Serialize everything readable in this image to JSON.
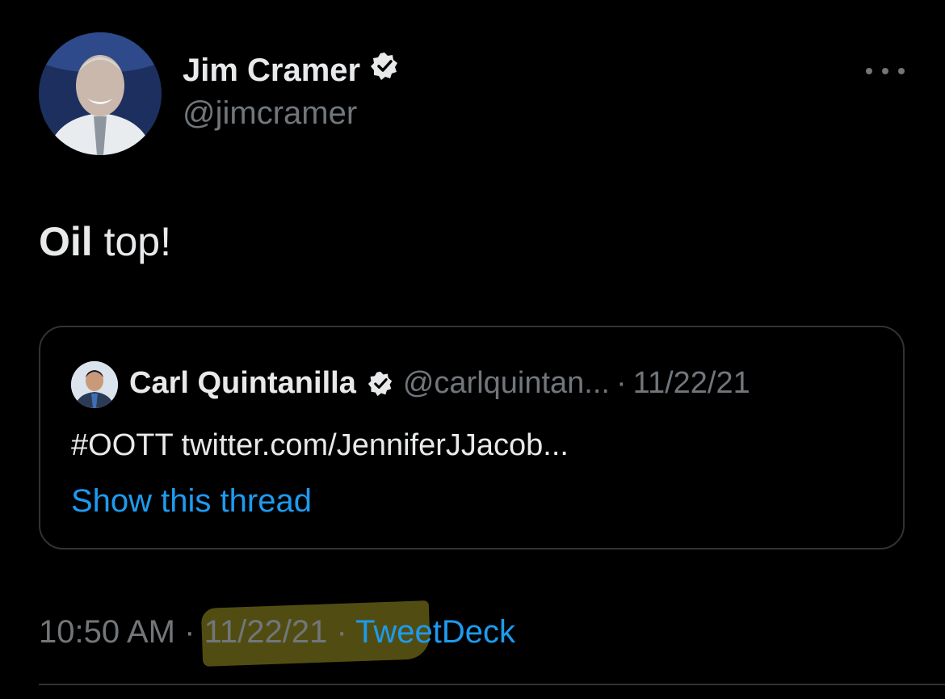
{
  "tweet": {
    "author_name": "Jim Cramer",
    "author_handle": "@jimcramer",
    "text_bold": "Oil",
    "text_rest": " top!",
    "time": "10:50 AM",
    "separator": "·",
    "date": "11/22/21",
    "source": "TweetDeck"
  },
  "quote": {
    "author_name": "Carl Quintanilla",
    "author_handle": "@carlquintan...",
    "separator": "·",
    "date": "11/22/21",
    "text": "#OOTT twitter.com/JenniferJJacob...",
    "show_thread": "Show this thread"
  },
  "icons": {
    "verified": "verified-badge-icon",
    "more": "more-options-icon"
  },
  "colors": {
    "background": "#000000",
    "text": "#e7e9ea",
    "secondary": "#71767b",
    "link": "#1d9bf0",
    "highlight": "#b4aa28"
  }
}
